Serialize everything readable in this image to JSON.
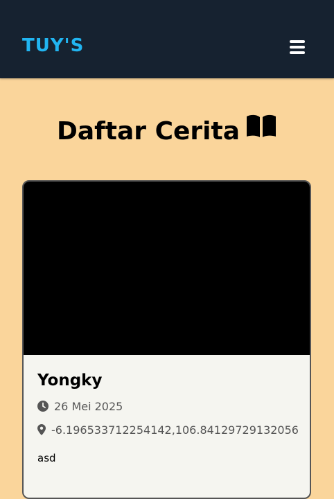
{
  "navbar": {
    "brand": "TUY'S",
    "menu_icon": "hamburger-menu-icon",
    "bg_color": "#162230",
    "brand_color": "#21b5f1"
  },
  "page": {
    "title": "Daftar Cerita",
    "title_icon": "open-book-icon",
    "bg_color": "#fad59b"
  },
  "stories": [
    {
      "name": "Yongky",
      "date_icon": "clock-icon",
      "date": "26 Mei 2025",
      "location_icon": "map-pin-icon",
      "location": "-6.196533712254142,106.84129729132056",
      "description": "asd"
    }
  ]
}
